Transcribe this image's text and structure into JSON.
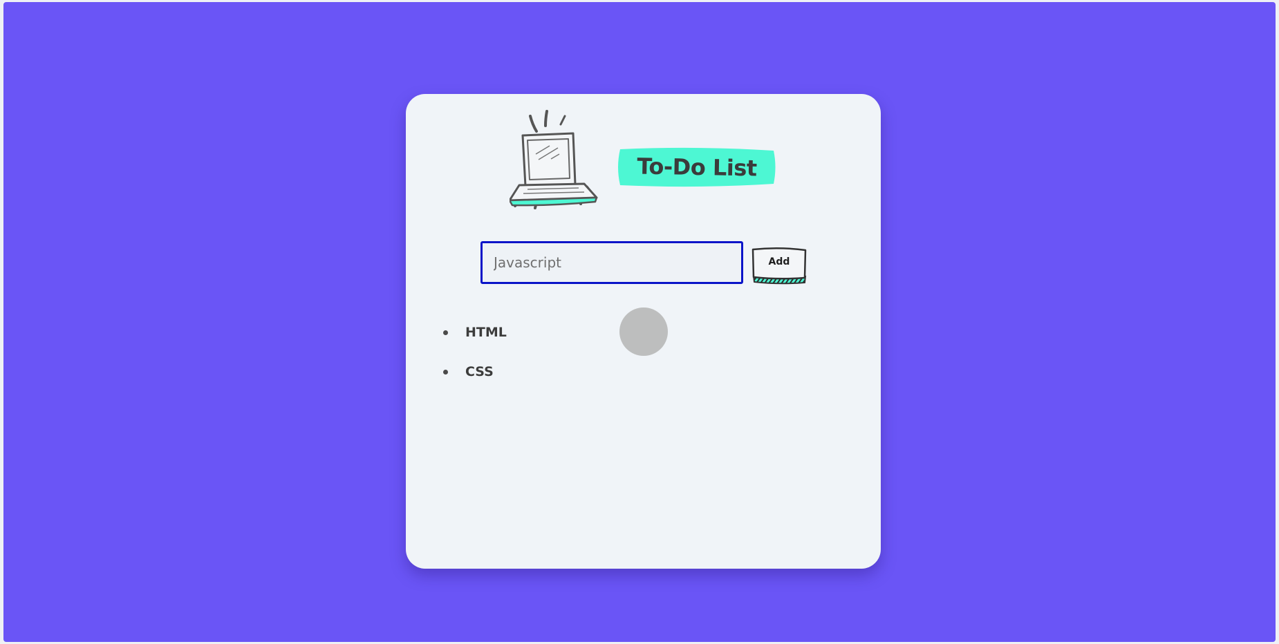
{
  "app": {
    "title": "To-Do List"
  },
  "form": {
    "input_value": "Javascript",
    "add_label": "Add"
  },
  "tasks": [
    {
      "label": "HTML"
    },
    {
      "label": "CSS"
    }
  ],
  "colors": {
    "background": "#6a55f6",
    "card": "#f0f4f8",
    "accent": "#4df7d3",
    "input_focus_border": "#0a14c8",
    "text": "#3b3b3b"
  },
  "icons": {
    "header": "laptop-illustration-icon",
    "cursor": "touch-indicator"
  }
}
